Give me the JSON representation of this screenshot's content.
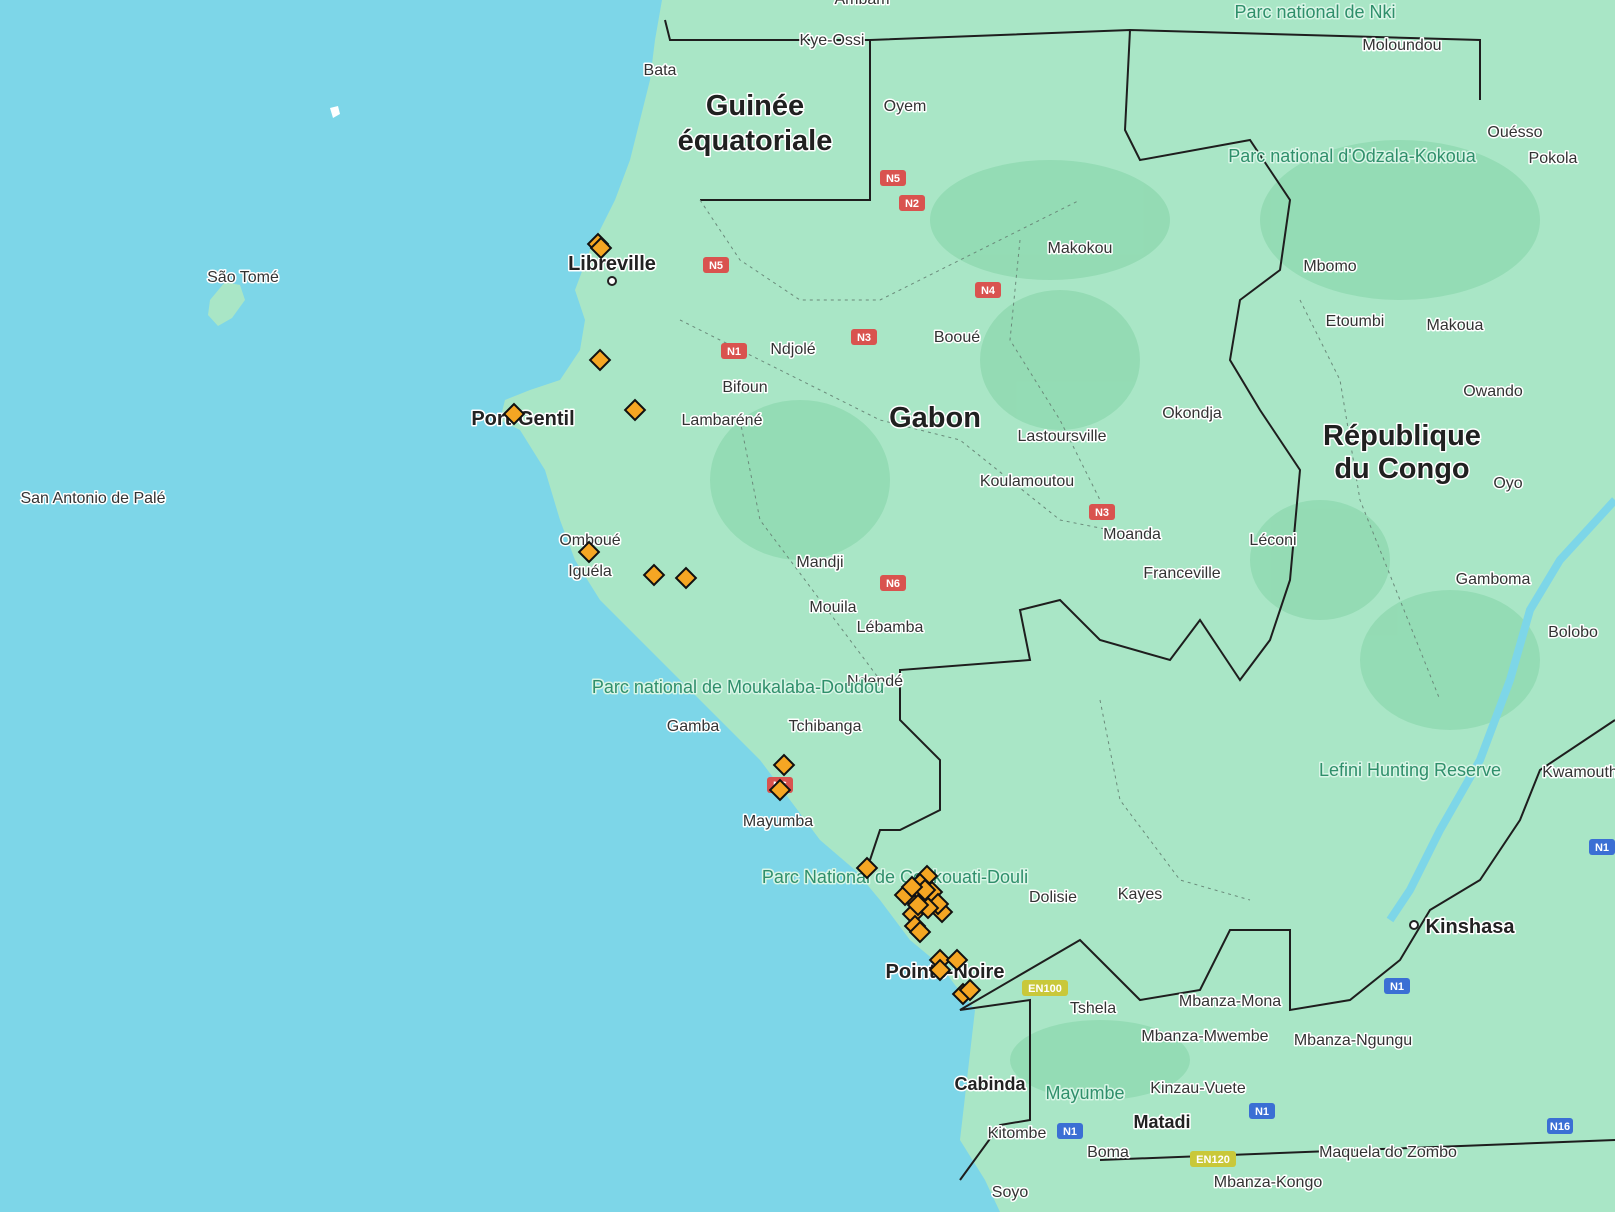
{
  "map": {
    "country_labels": [
      {
        "text": "Guinée",
        "line2": "équatoriale"
      },
      {
        "text": "Gabon"
      },
      {
        "text": "République",
        "line2": "du Congo"
      }
    ],
    "major_cities": [
      "Libreville",
      "Port-Gentil",
      "Pointe-Noire",
      "Kinshasa"
    ],
    "cities": [
      "Ambam",
      "Kye-Ossi",
      "Bata",
      "Oyem",
      "Makokou",
      "Mbomo",
      "Etoumbi",
      "Makoua",
      "Ouésso",
      "Pokola",
      "Moloundou",
      "São Tomé",
      "San Antonio de Palé",
      "Ndjolé",
      "Bifoun",
      "Lambaréné",
      "Booué",
      "Okondja",
      "Lastoursville",
      "Koulamoutou",
      "Moanda",
      "Franceville",
      "Léconi",
      "Oyo",
      "Owando",
      "Gamboma",
      "Bolobo",
      "Kwamouth",
      "Omboué",
      "Iguéla",
      "Mandji",
      "Mouila",
      "Lébamba",
      "Ndendé",
      "Tchibanga",
      "Gamba",
      "Mayumba",
      "Dolisie",
      "Kayes",
      "Tshela",
      "Mbanza-Mona",
      "Mbanza-Mwembe",
      "Mbanza-Ngungu",
      "Kinzau-Vuete",
      "Cabinda",
      "Matadi",
      "Kitombe",
      "Boma",
      "Maquela do Zombo",
      "Mbanza-Kongo",
      "Soyo"
    ],
    "parks": [
      "Parc national de Nki",
      "Parc national d'Odzala-Kokoua",
      "Parc national de Moukalaba-Doudou",
      "Parc National de Conkouati-Douli",
      "Lefini Hunting Reserve",
      "Mayumbe"
    ],
    "roads": [
      "N5",
      "N2",
      "N5",
      "N4",
      "N1",
      "N3",
      "N3",
      "N6",
      "N6",
      "EN100",
      "N1",
      "N1",
      "N1",
      "N16",
      "EN120",
      "N1"
    ],
    "marker_count": 31,
    "colors": {
      "ocean": "#7dd6e8",
      "land": "#a9e6c6",
      "forest": "#8fd9b0",
      "marker": "#f5a623",
      "road_red": "#d9534f",
      "road_blue": "#3b6fd4",
      "road_yellow": "#c9c83a"
    }
  }
}
